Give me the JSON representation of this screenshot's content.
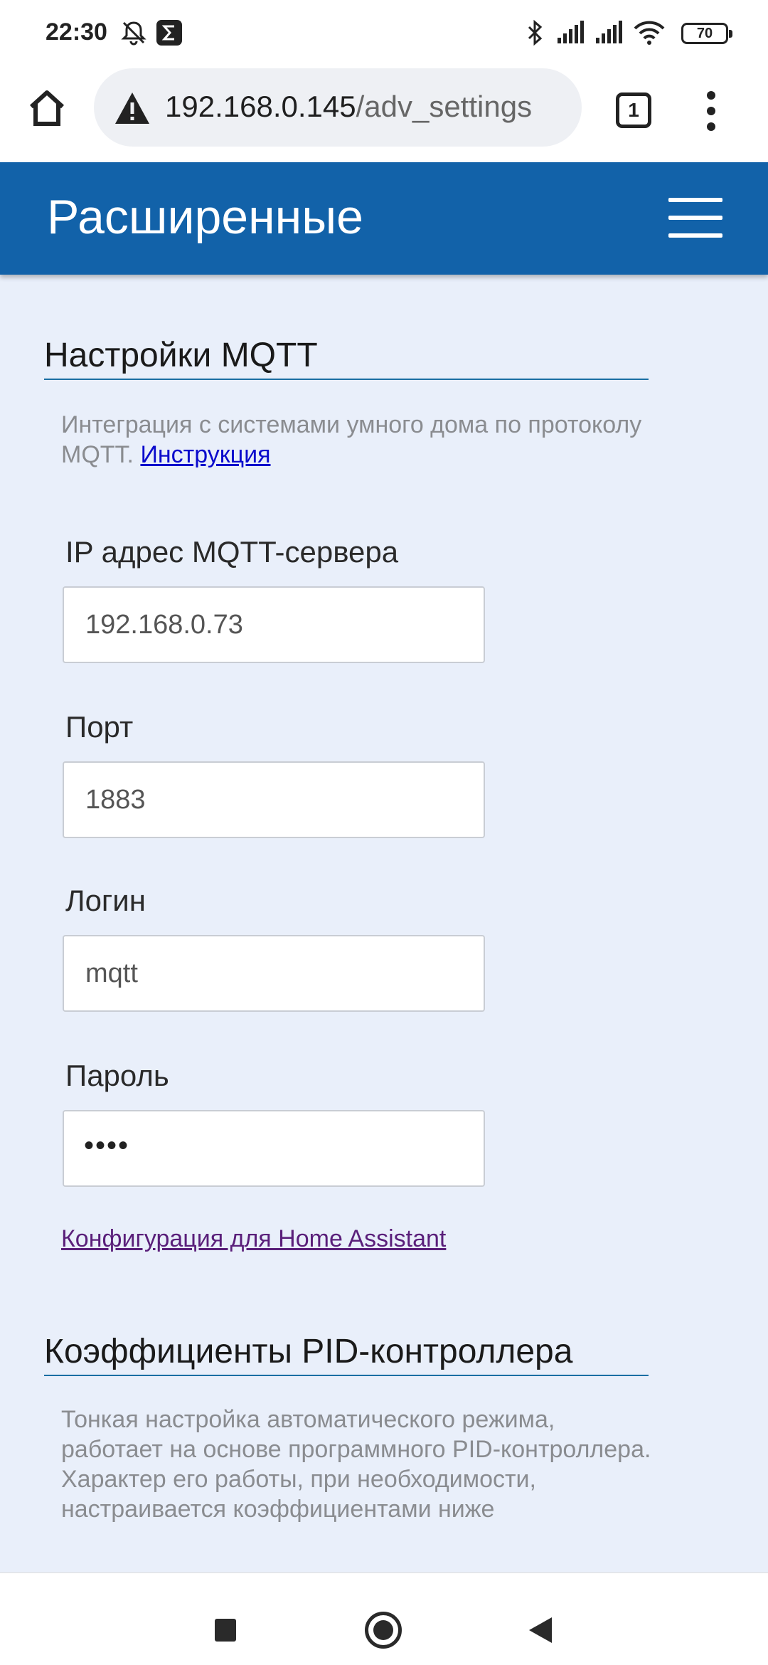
{
  "status_bar": {
    "time": "22:30",
    "icons": [
      "mute-icon",
      "sigma-notification-icon",
      "bluetooth-icon",
      "signal-icon",
      "signal-icon",
      "wifi-icon"
    ],
    "battery": "70"
  },
  "browser": {
    "home_icon": "home-icon",
    "warning_icon": "not-secure-warning-icon",
    "url_host": "192.168.0.145",
    "url_path": "/adv_settings",
    "tab_count": "1",
    "menu_icon": "more-vert-icon"
  },
  "header": {
    "title": "Расширенные",
    "menu_icon": "hamburger-menu-icon"
  },
  "mqtt": {
    "title": "Настройки MQTT",
    "description": "Интеграция с системами умного дома по протоколу MQTT. ",
    "instruction_link": "Инструкция",
    "fields": {
      "server_ip": {
        "label": "IP адрес MQTT-сервера",
        "value": "192.168.0.73"
      },
      "port": {
        "label": "Порт",
        "value": "1883"
      },
      "login": {
        "label": "Логин",
        "value": "mqtt"
      },
      "password": {
        "label": "Пароль",
        "value": "••••"
      }
    },
    "ha_link": "Конфигурация для Home Assistant"
  },
  "pid": {
    "title": "Коэффициенты PID-контроллера",
    "description": "Тонкая настройка автоматического режима, работает на основе программного PID-контроллера. Характер его работы, при необходимости, настраивается коэффициентами ниже"
  },
  "nav_bar": {
    "icons": [
      "recents-square-icon",
      "home-circle-icon",
      "back-triangle-icon"
    ]
  },
  "colors": {
    "header_bg": "#1262a9",
    "page_bg": "#e9effa",
    "link": "#0b0bcc",
    "visited_link": "#5a1f7a",
    "section_rule": "#1a6ea3"
  }
}
